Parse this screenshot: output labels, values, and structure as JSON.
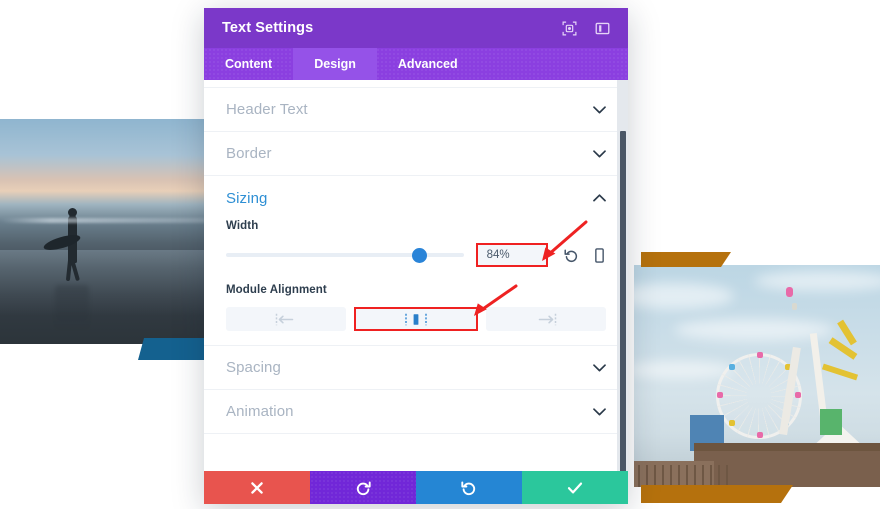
{
  "modal": {
    "title": "Text Settings",
    "title_icons": [
      {
        "name": "focus-target-icon",
        "label": "Focus"
      },
      {
        "name": "panel-layout-icon",
        "label": "Change panel layout"
      }
    ],
    "tabs": [
      {
        "label": "Content",
        "active": false
      },
      {
        "label": "Design",
        "active": true
      },
      {
        "label": "Advanced",
        "active": false
      }
    ],
    "sections": [
      {
        "label": "Header Text",
        "open": false,
        "chevron": "chevron-down"
      },
      {
        "label": "Border",
        "open": false,
        "chevron": "chevron-down"
      },
      {
        "label": "Sizing",
        "open": true,
        "chevron": "chevron-up"
      },
      {
        "label": "Spacing",
        "open": false,
        "chevron": "chevron-down"
      },
      {
        "label": "Animation",
        "open": false,
        "chevron": "chevron-down"
      }
    ],
    "sizing": {
      "width": {
        "label": "Width",
        "value": "84%",
        "slider_percent": 77,
        "reset_icon": "undo-reset-icon",
        "responsive_icon": "mobile-device-icon"
      },
      "module_alignment": {
        "label": "Module Alignment",
        "options": [
          {
            "name": "align-left",
            "selected": false
          },
          {
            "name": "align-center",
            "selected": true
          },
          {
            "name": "align-right",
            "selected": false
          }
        ]
      }
    },
    "footer_buttons": [
      {
        "name": "cancel-button",
        "icon": "x-icon",
        "color": "#e8544e"
      },
      {
        "name": "undo-button",
        "icon": "undo-icon",
        "color": "#7127d8"
      },
      {
        "name": "redo-button",
        "icon": "redo-icon",
        "color": "#2586d4"
      },
      {
        "name": "save-button",
        "icon": "check-icon",
        "color": "#2bc79c"
      }
    ],
    "colors": {
      "titlebar": "#7b38c9",
      "tabbar": "#8b3fe0",
      "tab_active": "#9552e8",
      "accent_blue": "#2e8fd4",
      "annotation_red": "#ef2121"
    }
  },
  "background": {
    "left_photo": {
      "name": "surfer-sunset-photo",
      "alt": "Surfer carrying board at sunset beach"
    },
    "left_banner_color": "#14618f",
    "right_photo": {
      "name": "pier-ferris-wheel-photo",
      "alt": "Ferris wheel on ocean pier"
    },
    "right_banner_color": "#b5710d"
  },
  "annotations": [
    {
      "name": "arrow-to-width-value",
      "target": "width-value-box"
    },
    {
      "name": "arrow-to-center-align",
      "target": "align-center-button"
    }
  ]
}
